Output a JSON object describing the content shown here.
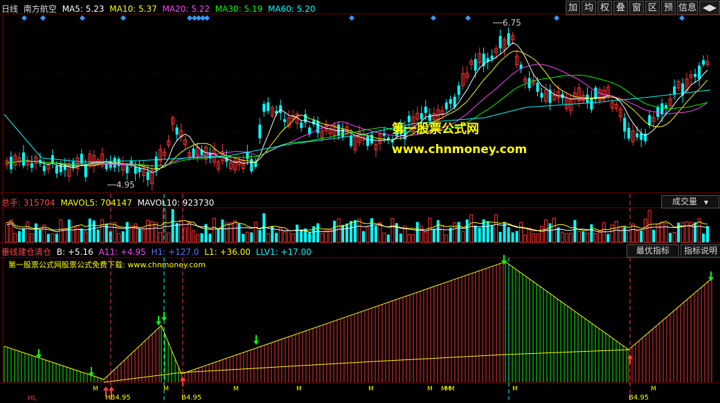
{
  "header": {
    "period": "日线",
    "stock": "南方航空",
    "ma5": "MA5: 5.23",
    "ma10": "MA10: 5.37",
    "ma20": "MA20: 5.22",
    "ma30": "MA30: 5.19",
    "ma60": "MA60: 5.20"
  },
  "toolbar": [
    "加",
    "均",
    "权",
    "叠",
    "窗",
    "区",
    "预",
    "信息",
    "◀▶"
  ],
  "colors": {
    "ma5": "#ffffff",
    "ma10": "#ffff00",
    "ma20": "#ff44ff",
    "ma30": "#00ff00",
    "ma60": "#00ffff",
    "up": "#ff3333",
    "down": "#00ffff",
    "watermark": "#ffff00"
  },
  "price_annotations": {
    "high": "6.75",
    "low": "4.95"
  },
  "watermark": {
    "title": "第一股票公式网",
    "url": "www.chnmoney.com"
  },
  "volume": {
    "total": "总手: 315704",
    "mavol5": "MAVOL5: 704147",
    "mavol10": "MAVOL10: 923730",
    "selector": "成交量"
  },
  "indicator": {
    "name": "垂线建仓清仓",
    "b": "B: +5.16",
    "a11": "A11: +4.95",
    "h1": "H1: +127.0",
    "l1": "L1: +36.00",
    "llv1": "LLV1: +17.00",
    "btn_best": "最优指标",
    "btn_help": "指标说明",
    "note": "第一股票公式网股票公式免费下载: www.chnmoney.com",
    "bottom_labels": {
      "hl": "HL",
      "b1": "HB4.95",
      "b2": "B4.95",
      "b3": "B4.95",
      "m": "M"
    }
  }
}
